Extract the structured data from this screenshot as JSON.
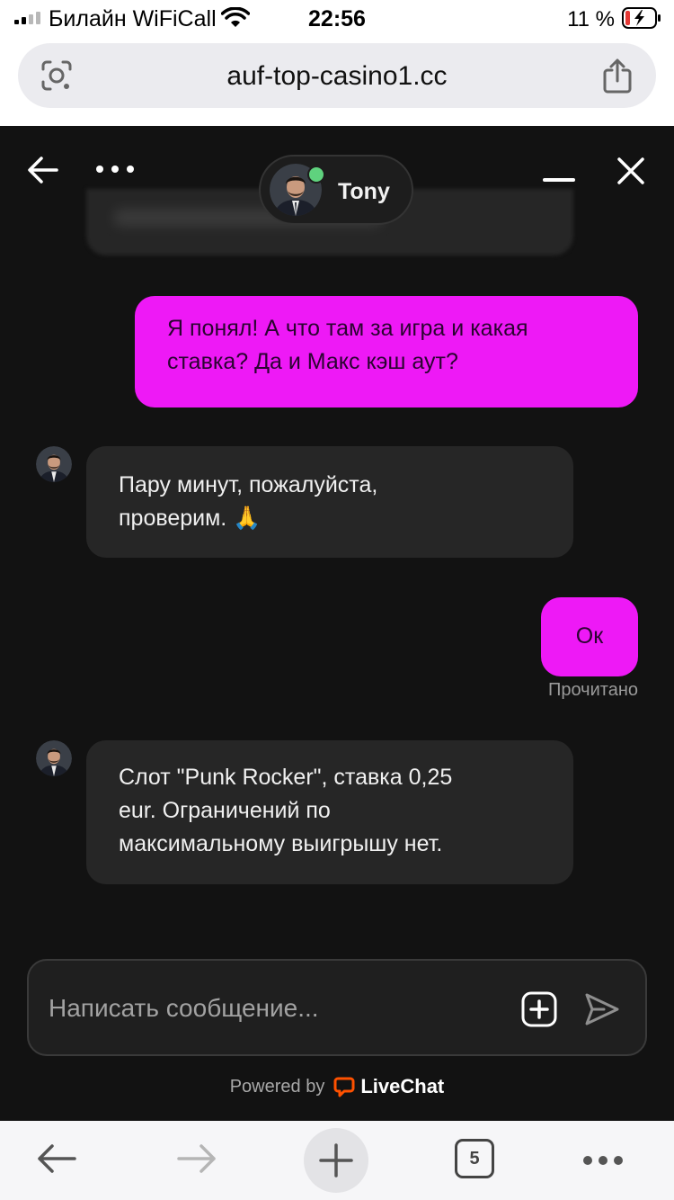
{
  "status_bar": {
    "carrier": "Билайн WiFiCall",
    "time": "22:56",
    "battery_percent": "11 %"
  },
  "browser": {
    "url": "auf-top-casino1.cc",
    "tab_count": "5",
    "icons": {
      "lens": "lens-icon",
      "share": "share-icon",
      "back": "arrow-left-icon",
      "forward": "arrow-right-icon",
      "new_tab": "plus-icon",
      "more": "more-icon"
    }
  },
  "chat": {
    "agent": {
      "name": "Tony",
      "status_color": "#5fd27e"
    },
    "messages": [
      {
        "sender": "visitor",
        "lines": [
          "Я понял! А что там за игра и какая",
          "ставка? Да и Макс кэш аут?"
        ]
      },
      {
        "sender": "agent",
        "lines": [
          "Пару минут, пожалуйста,",
          "проверим. 🙏"
        ]
      },
      {
        "sender": "visitor",
        "lines": [
          "Ок"
        ]
      },
      {
        "sender": "agent",
        "lines": [
          "Слот \"Punk Rocker\", ставка 0,25",
          "eur. Ограничений по",
          "максимальному выигрышу нет."
        ]
      }
    ],
    "read_receipt": "Прочитано",
    "composer": {
      "placeholder": "Написать сообщение..."
    },
    "powered_by": "Powered by",
    "brand": "LiveChat",
    "colors": {
      "background": "#121212",
      "visitor_bubble": "#ee19f6",
      "agent_bubble": "#262626",
      "brand_orange": "#ff5100"
    }
  }
}
